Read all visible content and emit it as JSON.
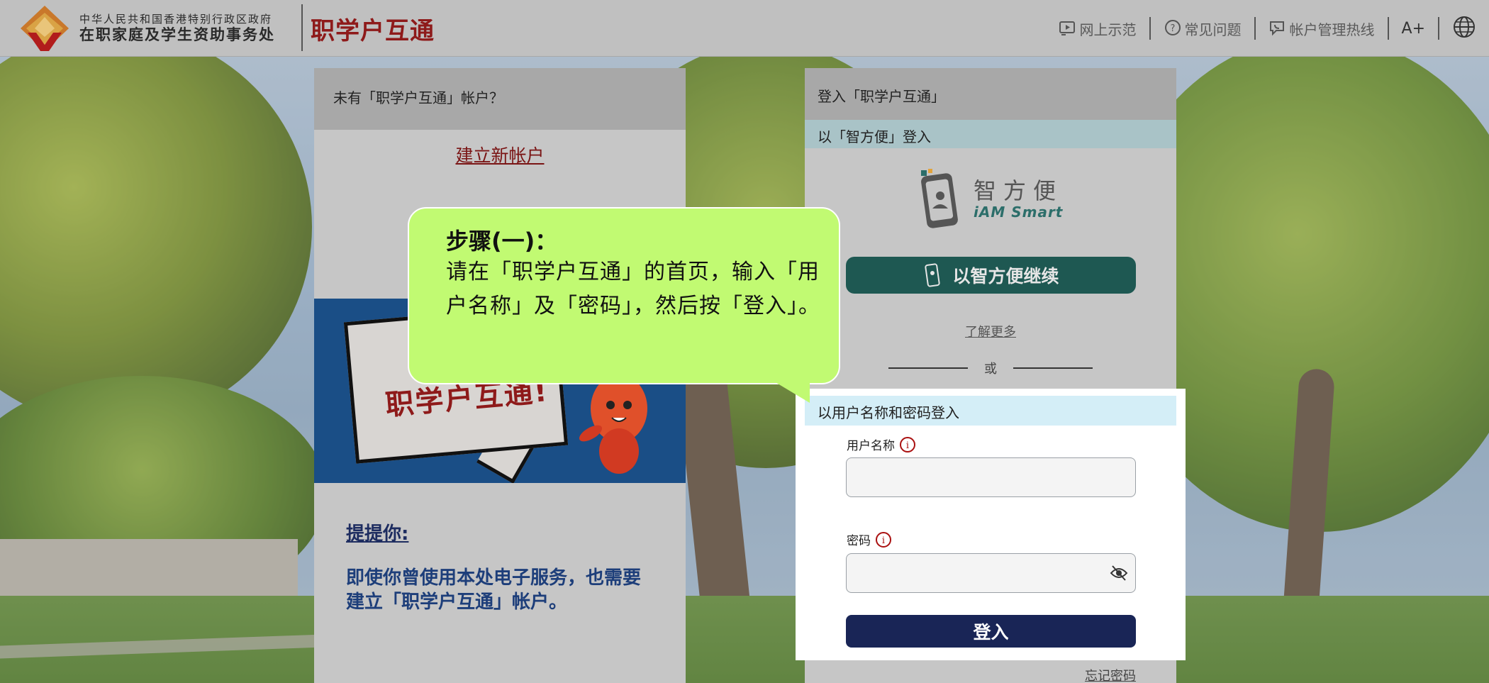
{
  "header": {
    "org_line1": "中华人民共和国香港特别行政区政府",
    "org_line2": "在职家庭及学生资助事务处",
    "brand": "职学户互通",
    "nav": [
      {
        "label": "网上示范",
        "icon": "video-icon"
      },
      {
        "label": "常见问题",
        "icon": "question-chat-icon"
      },
      {
        "label": "帐户管理热线",
        "icon": "phone-chat-icon"
      }
    ],
    "font_size_label": "A+",
    "language_icon": "globe-icon"
  },
  "left_panel": {
    "heading": "未有「职学户互通」帐户？",
    "create_link": "建立新帐户",
    "banner_text": "职学户互通!",
    "reminder_title": "提提你:",
    "reminder_body": "即使你曾使用本处电子服务，也需要建立「职学户互通」帐户。"
  },
  "right_panel": {
    "heading": "登入「职学户互通」",
    "iam_section": "以「智方便」登入",
    "iam_logo_cn": "智方便",
    "iam_logo_en": "iAM Smart",
    "iam_button": "以智方便继续",
    "learn_more": "了解更多",
    "or": "或",
    "password_section": "以用户名称和密码登入",
    "username_label": "用户名称",
    "password_label": "密码",
    "login_button": "登入",
    "forgot_password": "忘记密码"
  },
  "callout": {
    "title": "步骤(一)：",
    "text": "请在「职学户互通」的首页，输入「用户名称」及「密码」，然后按「登入」。"
  },
  "colors": {
    "brand_red": "#8e1a1a",
    "iam_green": "#1e5852",
    "login_navy": "#192556",
    "callout_green": "#c1fa72"
  }
}
